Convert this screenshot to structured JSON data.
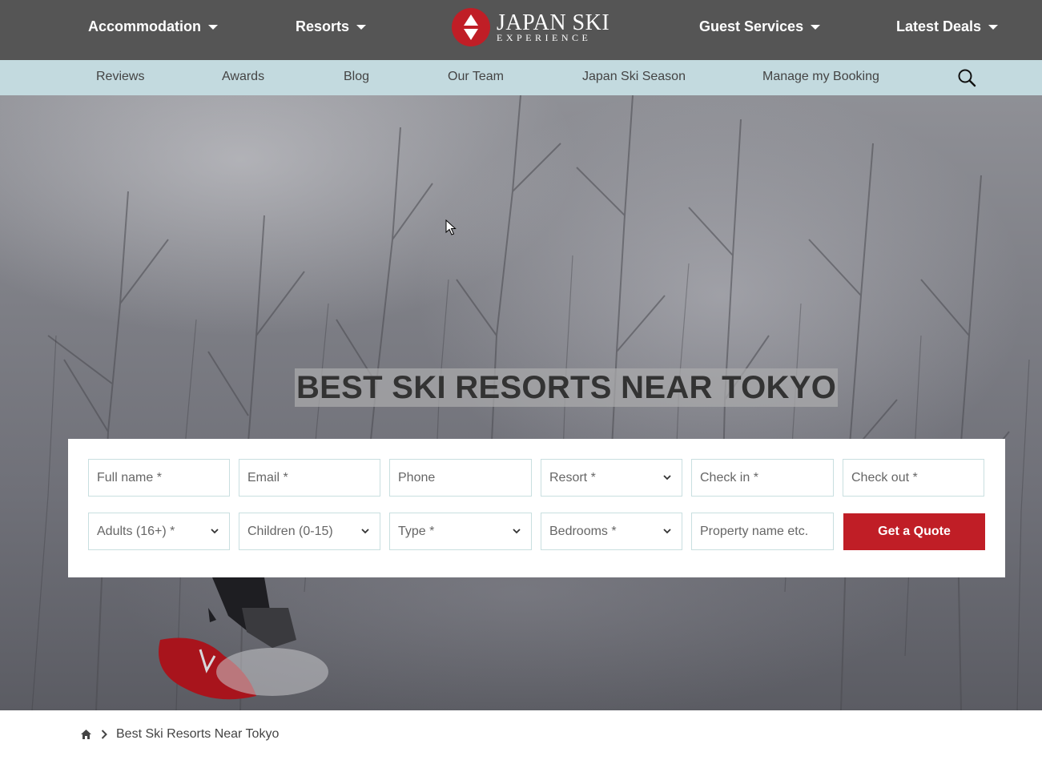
{
  "colors": {
    "top_nav_bg": "#555555",
    "sub_nav_bg": "#c3dadf",
    "accent_red": "#c01e26",
    "field_border": "#c9dfe0"
  },
  "top_nav": {
    "items": [
      {
        "label": "Accommodation",
        "icon": "caret-down-icon"
      },
      {
        "label": "Resorts",
        "icon": "caret-down-icon"
      },
      {
        "label": "Guest Services",
        "icon": "caret-down-icon"
      },
      {
        "label": "Latest Deals",
        "icon": "caret-down-icon"
      }
    ],
    "logo": {
      "main": "JAPAN SKI",
      "sub": "EXPERIENCE",
      "icon": "japan-ski-logo-icon"
    }
  },
  "sub_nav": {
    "items": [
      "Reviews",
      "Awards",
      "Blog",
      "Our Team",
      "Japan Ski Season",
      "Manage my Booking"
    ],
    "search_icon": "search-icon"
  },
  "hero": {
    "title": "BEST SKI RESORTS NEAR TOKYO"
  },
  "quote_form": {
    "full_name": "Full name *",
    "email": "Email *",
    "phone": "Phone",
    "resort": "Resort *",
    "check_in": "Check in *",
    "check_out": "Check out *",
    "adults": "Adults (16+) *",
    "children": "Children (0-15)",
    "type": "Type *",
    "bedrooms": "Bedrooms *",
    "property": "Property name etc.",
    "submit": "Get a Quote"
  },
  "breadcrumb": {
    "home_icon": "home-icon",
    "separator_icon": "chevron-right-icon",
    "current": "Best Ski Resorts Near Tokyo"
  }
}
